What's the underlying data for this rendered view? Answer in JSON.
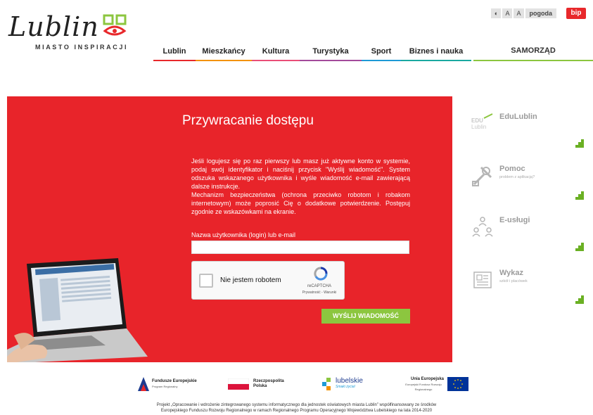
{
  "brand": {
    "logo_text": "Lublin",
    "tagline": "MIASTO INSPIRACJI"
  },
  "utilities": {
    "contrast": "◐",
    "font_a1": "A",
    "font_a2": "A",
    "weather": "pogoda",
    "bip": "bip"
  },
  "nav": {
    "items": [
      {
        "label": "Lublin",
        "color": "#e8282b"
      },
      {
        "label": "Mieszkańcy",
        "color": "#f39200"
      },
      {
        "label": "Kultura",
        "color": "#e94e77"
      },
      {
        "label": "Turystyka",
        "color": "#a34a9b"
      },
      {
        "label": "Sport",
        "color": "#1d9ad6"
      },
      {
        "label": "Biznes i nauka",
        "color": "#1aa9a0"
      }
    ],
    "samorzad": "SAMORZĄD"
  },
  "form": {
    "title": "Przywracanie dostępu",
    "intro": "Jeśli logujesz się po raz pierwszy lub masz już aktywne konto w systemie, podaj swój identyfikator i naciśnij przycisk \"Wyślij wiadomość\". System odszuka wskazanego użytkownika i wyśle wiadomość e-mail zawierającą dalsze instrukcje.",
    "security_note": "Mechanizm bezpieczeństwa (ochrona przeciwko robotom i robakom internetowym) może poprosić Cię o dodatkowe potwierdzenie. Postępuj zgodnie ze wskazówkami na ekranie.",
    "field_label": "Nazwa użytkownika (login) lub e-mail",
    "field_value": "",
    "captcha_label": "Nie jestem robotem",
    "captcha_brand": "reCAPTCHA",
    "captcha_links": "Prywatność - Warunki",
    "submit": "WYŚLIJ WIADOMOŚĆ"
  },
  "side_links": [
    {
      "title": "EduLublin",
      "sub": "",
      "icon": "edulublin-logo"
    },
    {
      "title": "Pomoc",
      "sub": "problem z aplikacją?",
      "icon": "tools-icon"
    },
    {
      "title": "E-usługi",
      "sub": "",
      "icon": "people-network-icon"
    },
    {
      "title": "Wykaz",
      "sub": "szkół i placówek",
      "icon": "newspaper-icon"
    }
  ],
  "footer_logos": {
    "fundusze": "Fundusze Europejskie",
    "fundusze_sub": "Program Regionalny",
    "rp": "Rzeczpospolita Polska",
    "lubelskie": "lubelskie",
    "lubelskie_sub": "Smaki życia!",
    "ue": "Unia Europejska",
    "ue_sub": "Europejski Fundusz Rozwoju Regionalnego"
  },
  "footer_note_1": "Projekt „Opracowanie i wdrożenie zintegrowanego systemu informatycznego dla jednostek oświatowych miasta Lublin” współfinansowany ze środków",
  "footer_note_2": "Europejskiego Funduszu Rozwoju Regionalnego w ramach Regionalnego Programu Operacyjnego Województwa Lubelskiego na lata 2014-2020",
  "colors": {
    "hero_red": "#e8242a",
    "accent_green": "#8cc63f",
    "bip_red": "#e8282b"
  }
}
